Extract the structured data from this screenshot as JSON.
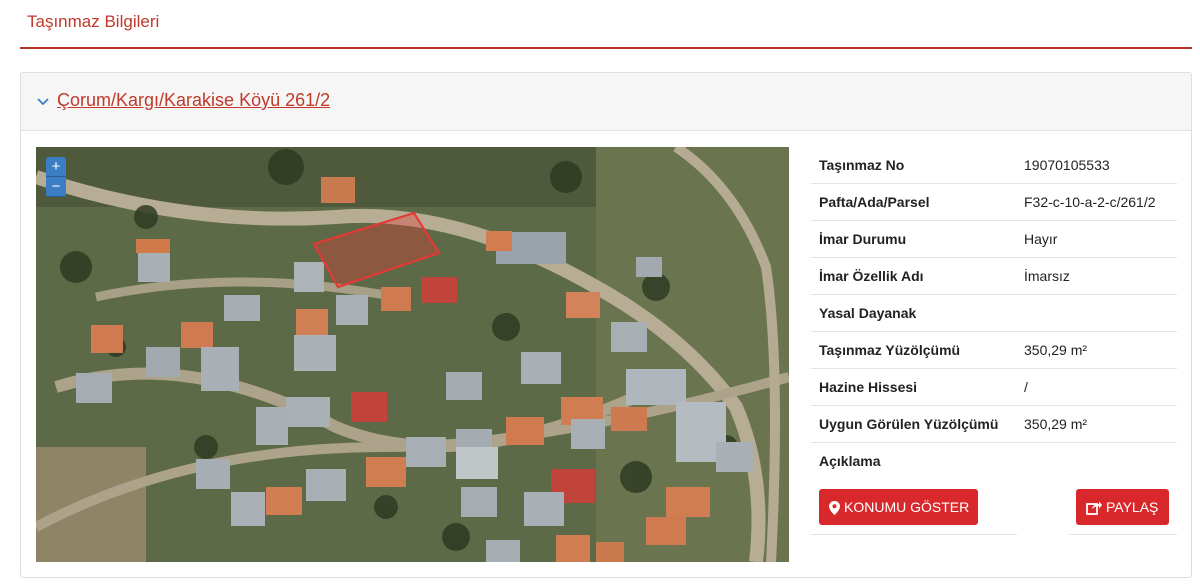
{
  "header": {
    "title": "Taşınmaz Bilgileri"
  },
  "parcel": {
    "link_label": "Çorum/Kargı/Karakise Köyü 261/2"
  },
  "map": {
    "zoom_in": "+",
    "zoom_out": "−",
    "highlight_color": "#e53935"
  },
  "info_rows": [
    {
      "key": "Taşınmaz No",
      "value": "19070105533"
    },
    {
      "key": "Pafta/Ada/Parsel",
      "value": "F32-c-10-a-2-c/261/2"
    },
    {
      "key": "İmar Durumu",
      "value": "Hayır"
    },
    {
      "key": "İmar Özellik Adı",
      "value": "İmarsız"
    },
    {
      "key": "Yasal Dayanak",
      "value": ""
    },
    {
      "key": "Taşınmaz Yüzölçümü",
      "value": "350,29 m²"
    },
    {
      "key": "Hazine Hissesi",
      "value": "/"
    },
    {
      "key": "Uygun Görülen Yüzölçümü",
      "value": "350,29 m²"
    },
    {
      "key": "Açıklama",
      "value": ""
    }
  ],
  "actions": {
    "show_location": "KONUMU GÖSTER",
    "share": "PAYLAŞ"
  },
  "colors": {
    "accent": "#c0392b",
    "button": "#d9282b",
    "zoom": "#3c7ec3"
  }
}
